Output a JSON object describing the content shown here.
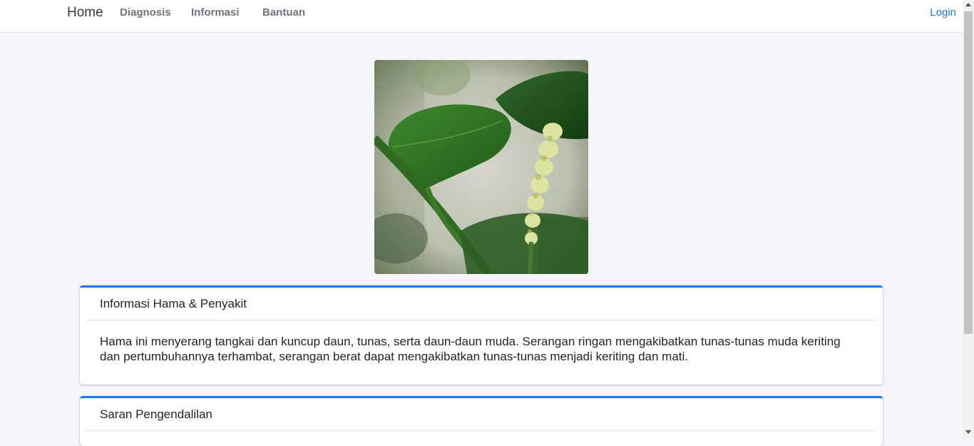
{
  "navbar": {
    "brand": "Home",
    "links": [
      "Diagnosis",
      "Informasi",
      "Bantuan"
    ],
    "login": "Login"
  },
  "image": {
    "alt": "pest-damaged plant shoot"
  },
  "cards": [
    {
      "title": "Informasi Hama & Penyakit",
      "body": "Hama ini menyerang tangkai dan kuncup daun, tunas, serta daun-daun muda. Serangan ringan mengakibatkan tunas-tunas muda keriting dan pertumbuhannya terhambat, serangan berat dapat mengakibatkan tunas-tunas menjadi keriting dan mati."
    },
    {
      "title": "Saran Pengendalilan"
    }
  ],
  "colors": {
    "accent": "#1a7ae6",
    "background": "#f4f6f9"
  }
}
